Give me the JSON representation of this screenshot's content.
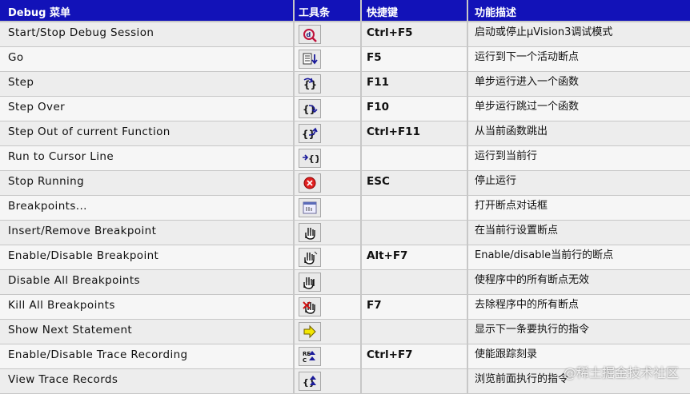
{
  "header": {
    "col_command": "Debug 菜单",
    "col_toolbar": "工具条",
    "col_shortcut": "快捷键",
    "col_description": "功能描述"
  },
  "colors": {
    "header_bg": "#1212b8",
    "row_bg": "#ededed",
    "grid": "#c7c7c7"
  },
  "rows": [
    {
      "command": "Start/Stop Debug Session",
      "icon": "debug-session-icon",
      "shortcut": "Ctrl+F5",
      "description": "启动或停止μVision3调试模式"
    },
    {
      "command": "Go",
      "icon": "go-icon",
      "shortcut": "F5",
      "description": "运行到下一个活动断点"
    },
    {
      "command": "Step",
      "icon": "step-into-icon",
      "shortcut": "F11",
      "description": "单步运行进入一个函数"
    },
    {
      "command": "Step Over",
      "icon": "step-over-icon",
      "shortcut": "F10",
      "description": "单步运行跳过一个函数"
    },
    {
      "command": "Step Out of current Function",
      "icon": "step-out-icon",
      "shortcut": "Ctrl+F11",
      "description": "从当前函数跳出"
    },
    {
      "command": "Run to Cursor Line",
      "icon": "run-to-cursor-icon",
      "shortcut": "",
      "description": "运行到当前行"
    },
    {
      "command": "Stop Running",
      "icon": "stop-icon",
      "shortcut": "ESC",
      "description": "停止运行"
    },
    {
      "command": "Breakpoints...",
      "icon": "breakpoints-dialog-icon",
      "shortcut": "",
      "description": "打开断点对话框"
    },
    {
      "command": "Insert/Remove Breakpoint",
      "icon": "hand-icon",
      "shortcut": "",
      "description": "在当前行设置断点"
    },
    {
      "command": "Enable/Disable Breakpoint",
      "icon": "hand-toggle-icon",
      "shortcut": "Alt+F7",
      "description": "Enable/disable当前行的断点"
    },
    {
      "command": "Disable All Breakpoints",
      "icon": "hand-all-icon",
      "shortcut": "",
      "description": "使程序中的所有断点无效"
    },
    {
      "command": "Kill All Breakpoints",
      "icon": "kill-breakpoints-icon",
      "shortcut": "F7",
      "description": "去除程序中的所有断点"
    },
    {
      "command": "Show Next Statement",
      "icon": "next-statement-arrow-icon",
      "shortcut": "",
      "description": "显示下一条要执行的指令"
    },
    {
      "command": "Enable/Disable Trace Recording",
      "icon": "trace-recording-icon",
      "shortcut": "Ctrl+F7",
      "description": "使能跟踪刻录"
    },
    {
      "command": "View Trace Records",
      "icon": "view-trace-icon",
      "shortcut": "",
      "description": "浏览前面执行的指令"
    }
  ],
  "watermark": "@稀土掘金技术社区"
}
